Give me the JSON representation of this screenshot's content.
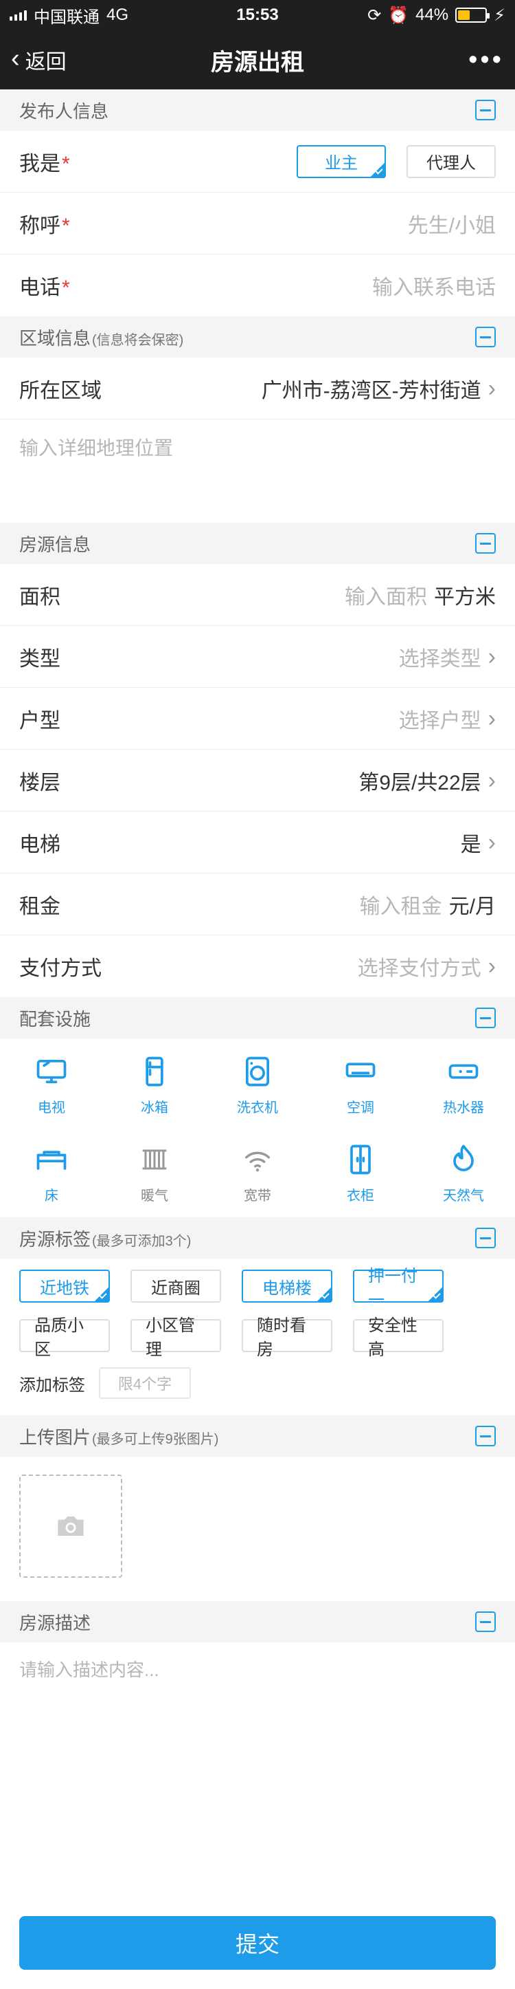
{
  "status_bar": {
    "carrier": "中国联通",
    "network": "4G",
    "time": "15:53",
    "battery": "44%"
  },
  "nav": {
    "back_label": "返回",
    "title": "房源出租"
  },
  "sections": {
    "publisher": {
      "title": "发布人信息",
      "role_label": "我是",
      "roles": [
        "业主",
        "代理人"
      ],
      "name_label": "称呼",
      "name_placeholder": "先生/小姐",
      "phone_label": "电话",
      "phone_placeholder": "输入联系电话"
    },
    "area": {
      "title": "区域信息",
      "title_note": "(信息将会保密)",
      "district_label": "所在区域",
      "district_value": "广州市-荔湾区-芳村街道",
      "address_placeholder": "输入详细地理位置"
    },
    "property": {
      "title": "房源信息",
      "rows": [
        {
          "label": "面积",
          "value": "输入面积",
          "unit": "平方米"
        },
        {
          "label": "类型",
          "value": "选择类型"
        },
        {
          "label": "户型",
          "value": "选择户型"
        },
        {
          "label": "楼层",
          "value": "第9层/共22层"
        },
        {
          "label": "电梯",
          "value": "是"
        },
        {
          "label": "租金",
          "value": "输入租金",
          "unit": "元/月"
        },
        {
          "label": "支付方式",
          "value": "选择支付方式"
        }
      ]
    },
    "facilities": {
      "title": "配套设施",
      "items": [
        {
          "label": "电视",
          "active": true
        },
        {
          "label": "冰箱",
          "active": true
        },
        {
          "label": "洗衣机",
          "active": true
        },
        {
          "label": "空调",
          "active": true
        },
        {
          "label": "热水器",
          "active": true
        },
        {
          "label": "床",
          "active": true
        },
        {
          "label": "暖气",
          "active": false
        },
        {
          "label": "宽带",
          "active": false
        },
        {
          "label": "衣柜",
          "active": true
        },
        {
          "label": "天然气",
          "active": true
        }
      ]
    },
    "tags": {
      "title": "房源标签",
      "title_note": "(最多可添加3个)",
      "items": [
        {
          "label": "近地铁",
          "selected": true
        },
        {
          "label": "近商圈",
          "selected": false
        },
        {
          "label": "电梯楼",
          "selected": true
        },
        {
          "label": "押一付一",
          "selected": true
        },
        {
          "label": "品质小区",
          "selected": false
        },
        {
          "label": "小区管理",
          "selected": false
        },
        {
          "label": "随时看房",
          "selected": false
        },
        {
          "label": "安全性高",
          "selected": false
        }
      ],
      "add_label": "添加标签",
      "add_placeholder": "限4个字"
    },
    "upload": {
      "title": "上传图片",
      "title_note": "(最多可上传9张图片)"
    },
    "description": {
      "title": "房源描述",
      "placeholder": "请输入描述内容..."
    }
  },
  "submit_label": "提交",
  "colors": {
    "accent": "#1E9BE9",
    "required": "#E53935"
  }
}
